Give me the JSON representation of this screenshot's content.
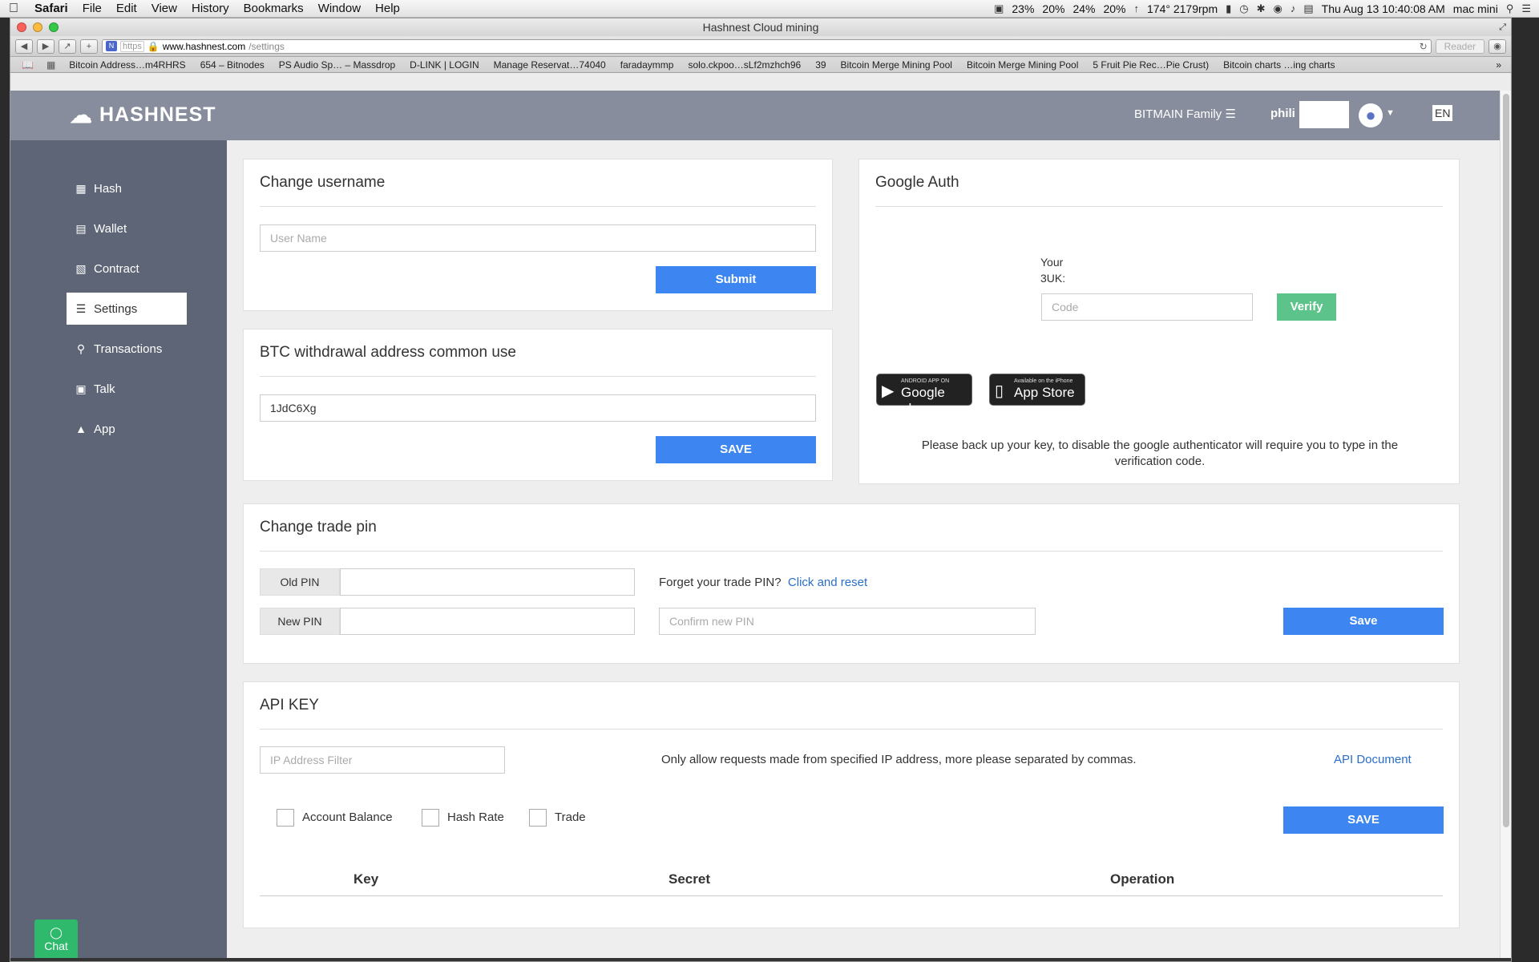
{
  "menubar": {
    "app": "Safari",
    "items": [
      "File",
      "Edit",
      "View",
      "History",
      "Bookmarks",
      "Window",
      "Help"
    ],
    "status": [
      "23%",
      "20%",
      "24%",
      "20%",
      "174° 2179rpm"
    ],
    "datetime": "Thu Aug 13  10:40:08 AM",
    "computer": "mac mini"
  },
  "window": {
    "title": "Hashnest Cloud mining"
  },
  "toolbar": {
    "url_scheme": "https",
    "url_host": "www.hashnest.com",
    "url_path": "/settings",
    "reader": "Reader"
  },
  "bookmarks": [
    "Bitcoin Address…m4RHRS",
    "654 – Bitnodes",
    "PS Audio Sp… – Massdrop",
    "D-LINK | LOGIN",
    "Manage Reservat…74040",
    "faradaymmp",
    "solo.ckpoo…sLf2mzhch96",
    "39",
    "Bitcoin Merge Mining Pool",
    "Bitcoin Merge Mining Pool",
    "5 Fruit Pie Rec…Pie Crust)",
    "Bitcoin charts …ing charts"
  ],
  "header": {
    "logo": "HASHNEST",
    "family": "BITMAIN Family",
    "user": "phili",
    "lang": "EN"
  },
  "sidebar": {
    "items": [
      {
        "label": "Hash"
      },
      {
        "label": "Wallet"
      },
      {
        "label": "Contract"
      },
      {
        "label": "Settings"
      },
      {
        "label": "Transactions"
      },
      {
        "label": "Talk"
      },
      {
        "label": "App"
      }
    ]
  },
  "username_card": {
    "title": "Change username",
    "placeholder": "User Name",
    "submit": "Submit"
  },
  "btc_card": {
    "title": "BTC withdrawal address common use",
    "value": "1JdC6Xg",
    "save": "SAVE"
  },
  "google_card": {
    "title": "Google Auth",
    "key_line1": "Your",
    "key_line2": "3UK:",
    "code_placeholder": "Code",
    "verify": "Verify",
    "google_play_small": "ANDROID APP ON",
    "google_play_big": "Google play",
    "app_store_small": "Available on the iPhone",
    "app_store_big": "App Store",
    "note": "Please back up your key, to disable the google authenticator will require you to type in the verification code."
  },
  "pin_card": {
    "title": "Change trade pin",
    "old_label": "Old PIN",
    "new_label": "New PIN",
    "forget": "Forget your trade PIN?",
    "reset": "Click and reset",
    "confirm_placeholder": "Confirm new PIN",
    "save": "Save"
  },
  "api_card": {
    "title": "API KEY",
    "ip_placeholder": "IP Address Filter",
    "note": "Only allow requests made from specified IP address, more please separated by commas.",
    "doc": "API Document",
    "perms": [
      "Account Balance",
      "Hash Rate",
      "Trade"
    ],
    "save": "SAVE",
    "columns": [
      "Key",
      "Secret",
      "Operation"
    ]
  },
  "chat": {
    "label": "Chat"
  },
  "colors": {
    "header": "#878d9c",
    "sidebar": "#5d6576",
    "primary_button": "#3d86f2",
    "verify_button": "#5cc38a",
    "chat": "#2fb96c"
  }
}
